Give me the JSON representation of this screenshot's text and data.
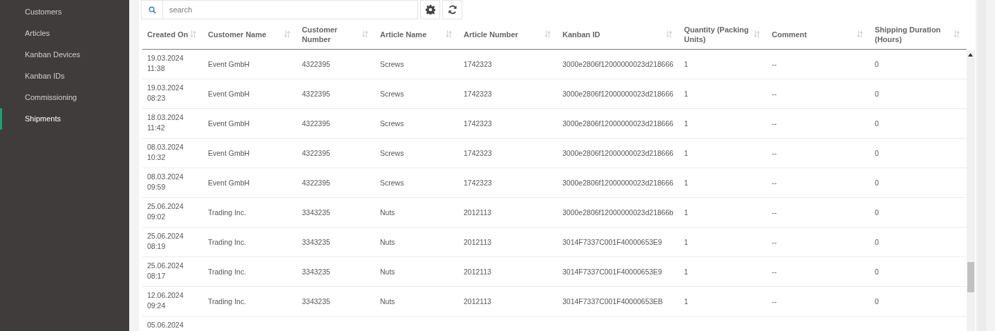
{
  "sidebar": {
    "items": [
      {
        "label": "Customers",
        "selected": false
      },
      {
        "label": "Articles",
        "selected": false
      },
      {
        "label": "Kanban Devices",
        "selected": false
      },
      {
        "label": "Kanban IDs",
        "selected": false
      },
      {
        "label": "Commissioning",
        "selected": false
      },
      {
        "label": "Shipments",
        "selected": true
      }
    ]
  },
  "search": {
    "placeholder": "search"
  },
  "table": {
    "columns": [
      "Created On",
      "Customer Name",
      "Customer Number",
      "Article Name",
      "Article Number",
      "Kanban ID",
      "Quantity (Packing Units)",
      "Comment",
      "Shipping Duration (Hours)"
    ],
    "rows": [
      [
        "19.03.2024 11:38",
        "Event GmbH",
        "4322395",
        "Screws",
        "1742323",
        "3000e2806f12000000023d218666",
        "1",
        "--",
        "0"
      ],
      [
        "19.03.2024 08:23",
        "Event GmbH",
        "4322395",
        "Screws",
        "1742323",
        "3000e2806f12000000023d218666",
        "1",
        "--",
        "0"
      ],
      [
        "18.03.2024 11:42",
        "Event GmbH",
        "4322395",
        "Screws",
        "1742323",
        "3000e2806f12000000023d218666",
        "1",
        "--",
        "0"
      ],
      [
        "08.03.2024 10:32",
        "Event GmbH",
        "4322395",
        "Screws",
        "1742323",
        "3000e2806f12000000023d218666",
        "1",
        "--",
        "0"
      ],
      [
        "08.03.2024 09:59",
        "Event GmbH",
        "4322395",
        "Screws",
        "1742323",
        "3000e2806f12000000023d218666",
        "1",
        "--",
        "0"
      ],
      [
        "25.06.2024 09:02",
        "Trading Inc.",
        "3343235",
        "Nuts",
        "2012113",
        "3000e2806f12000000023d21866b",
        "1",
        "--",
        "0"
      ],
      [
        "25.06.2024 08:19",
        "Trading Inc.",
        "3343235",
        "Nuts",
        "2012113",
        "3014F7337C001F40000653E9",
        "1",
        "--",
        "0"
      ],
      [
        "25.06.2024 08:17",
        "Trading Inc.",
        "3343235",
        "Nuts",
        "2012113",
        "3014F7337C001F40000653E9",
        "1",
        "--",
        "0"
      ],
      [
        "12.06.2024 09:24",
        "Trading Inc.",
        "3343235",
        "Nuts",
        "2012113",
        "3014F7337C001F40000653EB",
        "1",
        "--",
        "0"
      ],
      [
        "05.06.2024"
      ]
    ]
  }
}
